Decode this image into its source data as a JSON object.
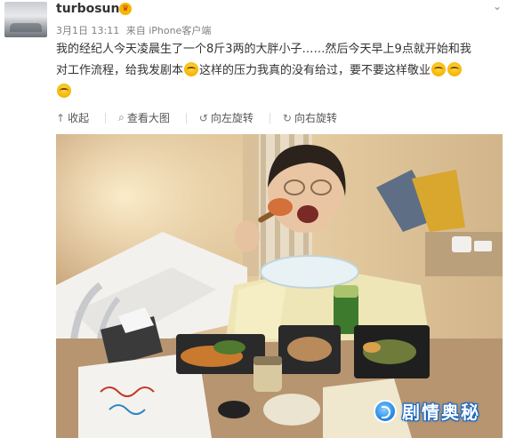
{
  "post": {
    "username": "turbosun",
    "date": "3月1日 13:11",
    "source": "来自 iPhone客户端",
    "text_line1": "我的经纪人今天凌晨生了一个8斤3两的大胖小子……然后今天早上9点就开始和我",
    "text_line2a": "对工作流程，给我发剧本",
    "text_line2b": "这样的压力我真的没有给过，要不要这样敬业"
  },
  "actions": {
    "collect": "收起",
    "view_large": "查看大图",
    "rotate_left": "向左旋转",
    "rotate_right": "向右旋转"
  },
  "watermark": {
    "text": "剧情奥秘"
  },
  "icons": {
    "vip": "crown-icon",
    "more": "chevron-down-icon",
    "emoji": "laughing-emoji-icon",
    "collect": "collapse-icon",
    "view_large": "search-icon",
    "rotate_left": "rotate-left-icon",
    "rotate_right": "rotate-right-icon"
  },
  "colors": {
    "username": "#333333",
    "meta": "#808080",
    "watermark": "#2b8ce6"
  }
}
